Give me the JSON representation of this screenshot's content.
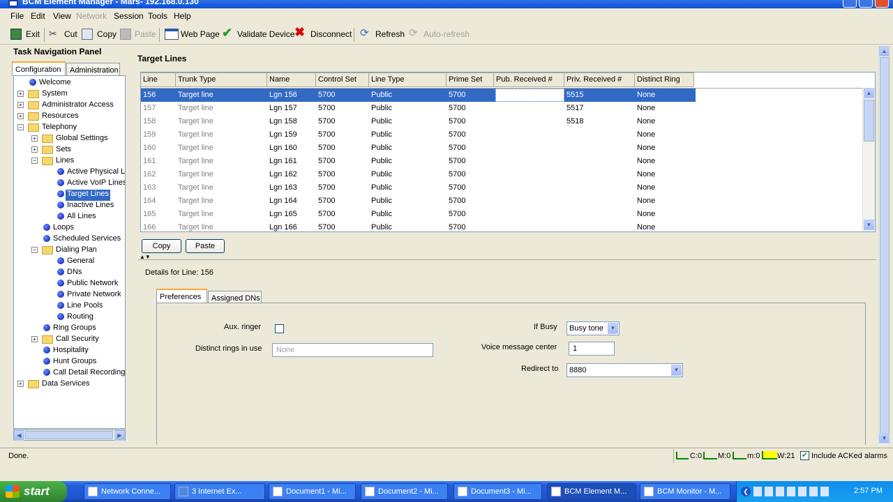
{
  "window": {
    "title": "BCM Element Manager - Mars- 192.168.0.130"
  },
  "menu": [
    "File",
    "Edit",
    "View",
    "Network",
    "Session",
    "Tools",
    "Help"
  ],
  "toolbar": {
    "exit": "Exit",
    "cut": "Cut",
    "copy": "Copy",
    "paste": "Paste",
    "webpage": "Web Page",
    "validate": "Validate Device",
    "disconnect": "Disconnect",
    "refresh": "Refresh",
    "autorefresh": "Auto-refresh"
  },
  "nav": {
    "title": "Task Navigation Panel",
    "tabs": [
      "Configuration",
      "Administration"
    ],
    "items": [
      "Welcome",
      "System",
      "Administrator Access",
      "Resources",
      "Telephony",
      "Global Settings",
      "Sets",
      "Lines",
      "Active Physical L",
      "Active VoIP Lines",
      "Target Lines",
      "Inactive Lines",
      "All Lines",
      "Loops",
      "Scheduled Services",
      "Dialing Plan",
      "General",
      "DNs",
      "Public Network",
      "Private Network",
      "Line Pools",
      "Routing",
      "Ring Groups",
      "Call Security",
      "Hospitality",
      "Hunt Groups",
      "Call Detail Recording",
      "Data Services"
    ]
  },
  "main": {
    "title": "Target Lines",
    "columns": [
      "Line",
      "Trunk Type",
      "Name",
      "Control Set",
      "Line Type",
      "Prime Set",
      "Pub. Received #",
      "Priv. Received #",
      "Distinct Ring"
    ],
    "rows": [
      [
        "156",
        "Target line",
        "Lgn 156",
        "5700",
        "Public",
        "5700",
        "",
        "5515",
        "None"
      ],
      [
        "157",
        "Target line",
        "Lgn 157",
        "5700",
        "Public",
        "5700",
        "",
        "5517",
        "None"
      ],
      [
        "158",
        "Target line",
        "Lgn 158",
        "5700",
        "Public",
        "5700",
        "",
        "5518",
        "None"
      ],
      [
        "159",
        "Target line",
        "Lgn 159",
        "5700",
        "Public",
        "5700",
        "",
        "",
        "None"
      ],
      [
        "160",
        "Target line",
        "Lgn 160",
        "5700",
        "Public",
        "5700",
        "",
        "",
        "None"
      ],
      [
        "161",
        "Target line",
        "Lgn 161",
        "5700",
        "Public",
        "5700",
        "",
        "",
        "None"
      ],
      [
        "162",
        "Target line",
        "Lgn 162",
        "5700",
        "Public",
        "5700",
        "",
        "",
        "None"
      ],
      [
        "163",
        "Target line",
        "Lgn 163",
        "5700",
        "Public",
        "5700",
        "",
        "",
        "None"
      ],
      [
        "164",
        "Target line",
        "Lgn 164",
        "5700",
        "Public",
        "5700",
        "",
        "",
        "None"
      ],
      [
        "165",
        "Target line",
        "Lgn 165",
        "5700",
        "Public",
        "5700",
        "",
        "",
        "None"
      ],
      [
        "166",
        "Target line",
        "Lgn 166",
        "5700",
        "Public",
        "5700",
        "",
        "",
        "None"
      ]
    ],
    "copy_btn": "Copy",
    "paste_btn": "Paste"
  },
  "details": {
    "title": "Details for Line: 156",
    "tabs": [
      "Preferences",
      "Assigned DNs"
    ],
    "aux_ringer": "Aux. ringer",
    "distinct_rings": "Distinct rings in use",
    "distinct_rings_value": "None",
    "if_busy": "If Busy",
    "if_busy_value": "Busy tone",
    "vmc": "Voice message center",
    "vmc_value": "1",
    "redirect": "Redirect to",
    "redirect_value": "8880"
  },
  "status": {
    "text": "Done.",
    "c": "C:0",
    "M": "M:0",
    "m": "m:0",
    "W": "W:21",
    "include": "Include ACKed alarms"
  },
  "taskbar": {
    "start": "start",
    "tasks": [
      "Network Conne...",
      "3 Internet Ex...",
      "Document1 - Mi...",
      "Document2 - Mi...",
      "Document3 - Mi...",
      "BCM Element M...",
      "BCM Monitor - M..."
    ],
    "clock": "2:57 PM"
  },
  "colors": {
    "selection": "#316ac5",
    "titlebar": "#0a4fd6",
    "taskbar": "#245edb",
    "start": "#3c9a3a"
  }
}
